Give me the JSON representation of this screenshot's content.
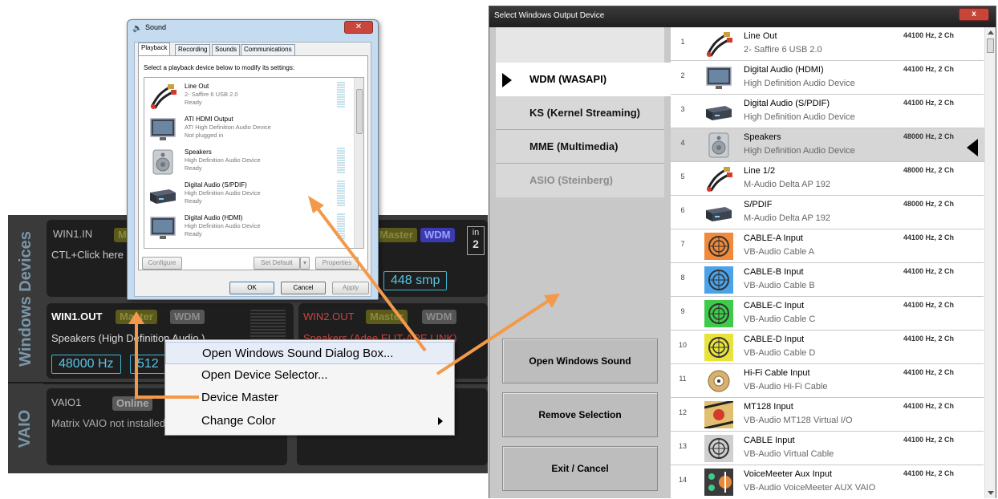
{
  "vm": {
    "side_windows_devices": "Windows Devices",
    "side_vaio": "VAIO",
    "win1in": {
      "title": "WIN1.IN",
      "tag_master": "Master",
      "sub": "CTL+Click here"
    },
    "win2in": {
      "tag_master": "Master",
      "tag_wdm": "WDM",
      "io_top": "in",
      "io_bottom": "2",
      "buffer": "448 smp"
    },
    "win1out": {
      "title": "WIN1.OUT",
      "tag_master": "Master",
      "tag_wdm": "WDM",
      "sub": "Speakers (High Definition Audio )",
      "rate": "48000 Hz",
      "buffer": "512"
    },
    "win2out": {
      "title": "WIN2.OUT",
      "tag_master": "Master",
      "tag_wdm": "WDM",
      "sub": "Speakers (Adee ELIT-ARE LINK)"
    },
    "vaio1": {
      "title": "VAIO1",
      "tag": "Online",
      "sub": "Matrix VAIO not installed"
    }
  },
  "sound": {
    "title": "Sound",
    "close": "✕",
    "tabs": [
      "Playback",
      "Recording",
      "Sounds",
      "Communications"
    ],
    "instruction": "Select a playback device below to modify its settings:",
    "devices": [
      {
        "name": "Line Out",
        "sub": "2- Saffire 6 USB 2.0",
        "state": "Ready",
        "icon": "cable"
      },
      {
        "name": "ATI HDMI Output",
        "sub": "ATI High Definition Audio Device",
        "state": "Not plugged in",
        "icon": "monitor"
      },
      {
        "name": "Speakers",
        "sub": "High Definition Audio Device",
        "state": "Ready",
        "icon": "speaker"
      },
      {
        "name": "Digital Audio (S/PDIF)",
        "sub": "High Definition Audio Device",
        "state": "Ready",
        "icon": "spdif"
      },
      {
        "name": "Digital Audio (HDMI)",
        "sub": "High Definition Audio Device",
        "state": "Ready",
        "icon": "monitor"
      }
    ],
    "buttons": {
      "configure": "Configure",
      "set_default": "Set Default",
      "properties": "Properties",
      "ok": "OK",
      "cancel": "Cancel",
      "apply": "Apply"
    }
  },
  "context_menu": {
    "items": [
      "Open Windows Sound Dialog Box...",
      "Open Device Selector...",
      "Device Master",
      "Change Color"
    ]
  },
  "selector": {
    "title": "Select Windows Output Device",
    "close": "x",
    "drivers": [
      "WDM (WASAPI)",
      "KS (Kernel Streaming)",
      "MME (Multimedia)",
      "ASIO (Steinberg)"
    ],
    "actions": [
      "Open Windows Sound",
      "Remove Selection",
      "Exit / Cancel"
    ],
    "rows": [
      {
        "num": "1",
        "name": "Line Out",
        "sub": "2- Saffire 6 USB 2.0",
        "fmt": "44100 Hz, 2 Ch",
        "icon": "cable",
        "color": ""
      },
      {
        "num": "2",
        "name": "Digital Audio (HDMI)",
        "sub": "High Definition Audio Device",
        "fmt": "44100 Hz, 2 Ch",
        "icon": "monitor",
        "color": ""
      },
      {
        "num": "3",
        "name": "Digital Audio (S/PDIF)",
        "sub": "High Definition Audio Device",
        "fmt": "44100 Hz, 2 Ch",
        "icon": "spdif",
        "color": ""
      },
      {
        "num": "4",
        "name": "Speakers",
        "sub": "High Definition Audio Device",
        "fmt": "48000 Hz, 2 Ch",
        "icon": "speaker",
        "color": ""
      },
      {
        "num": "5",
        "name": "Line 1/2",
        "sub": "M-Audio Delta AP 192",
        "fmt": "48000 Hz, 2 Ch",
        "icon": "cable",
        "color": ""
      },
      {
        "num": "6",
        "name": "S/PDIF",
        "sub": "M-Audio Delta AP 192",
        "fmt": "48000 Hz, 2 Ch",
        "icon": "spdif",
        "color": ""
      },
      {
        "num": "7",
        "name": "CABLE-A Input",
        "sub": "VB-Audio Cable A",
        "fmt": "44100 Hz, 2 Ch",
        "icon": "coil",
        "color": "#f0893a"
      },
      {
        "num": "8",
        "name": "CABLE-B Input",
        "sub": "VB-Audio Cable B",
        "fmt": "44100 Hz, 2 Ch",
        "icon": "coil",
        "color": "#4aa3e8"
      },
      {
        "num": "9",
        "name": "CABLE-C Input",
        "sub": "VB-Audio Cable C",
        "fmt": "44100 Hz, 2 Ch",
        "icon": "coil",
        "color": "#3ecb4a"
      },
      {
        "num": "10",
        "name": "CABLE-D Input",
        "sub": "VB-Audio Cable D",
        "fmt": "44100 Hz, 2 Ch",
        "icon": "coil",
        "color": "#e8e23a"
      },
      {
        "num": "11",
        "name": "Hi-Fi Cable Input",
        "sub": "VB-Audio Hi-Fi Cable",
        "fmt": "44100 Hz, 2 Ch",
        "icon": "rca",
        "color": "#d8b070"
      },
      {
        "num": "12",
        "name": "MT128 Input",
        "sub": "VB-Audio MT128 Virtual I/O",
        "fmt": "44100 Hz, 2 Ch",
        "icon": "mt128",
        "color": "#e0c070"
      },
      {
        "num": "13",
        "name": "CABLE Input",
        "sub": "VB-Audio Virtual Cable",
        "fmt": "44100 Hz, 2 Ch",
        "icon": "coil",
        "color": "#cfcfcf"
      },
      {
        "num": "14",
        "name": "VoiceMeeter Aux Input",
        "sub": "VB-Audio VoiceMeeter AUX VAIO",
        "fmt": "44100 Hz, 2 Ch",
        "icon": "vm",
        "color": "#3a3a3a"
      }
    ]
  },
  "colors": {
    "arrow": "#f29a4a",
    "vm_dark": "#1e1e1e",
    "vm_bg": "#3a3a3a",
    "vm_cyan": "#56c6e6"
  }
}
